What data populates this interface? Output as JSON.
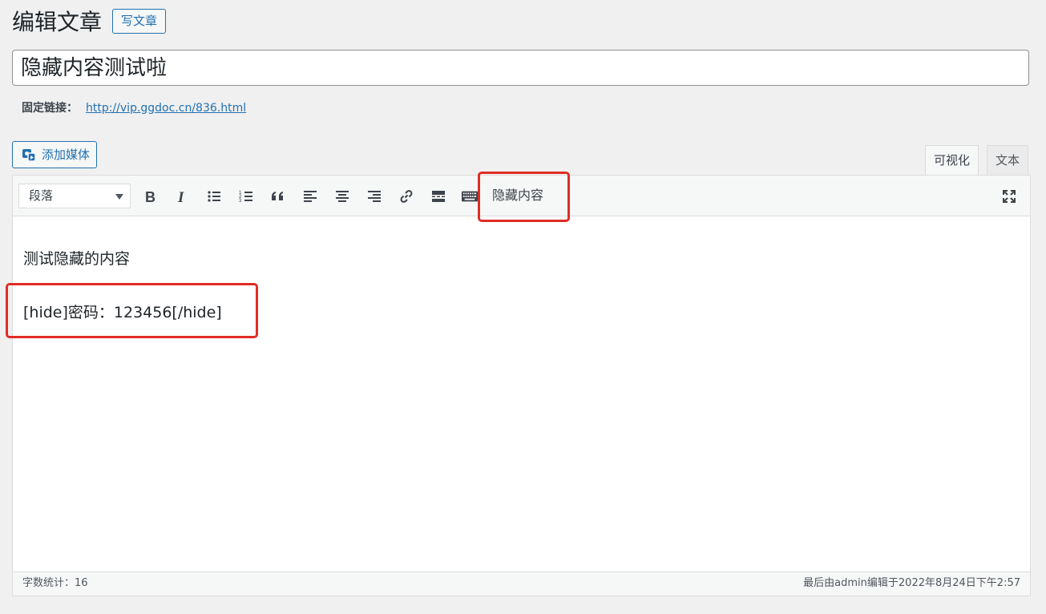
{
  "header": {
    "title": "编辑文章",
    "add_new_label": "写文章"
  },
  "post": {
    "title": "隐藏内容测试啦",
    "permalink_label": "固定链接：",
    "permalink_url": "http://vip.ggdoc.cn/836.html"
  },
  "media": {
    "add_media_label": "添加媒体"
  },
  "tabs": {
    "visual": "可视化",
    "text": "文本"
  },
  "toolbar": {
    "format_selected": "段落",
    "buttons": [
      "bold-icon",
      "italic-icon",
      "bullet-list-icon",
      "numbered-list-icon",
      "blockquote-icon",
      "align-left-icon",
      "align-center-icon",
      "align-right-icon",
      "link-icon",
      "read-more-icon",
      "toolbar-toggle-icon",
      "fullscreen-icon"
    ],
    "hide_content_label": "隐藏内容"
  },
  "content": {
    "paragraph_1": "测试隐藏的内容",
    "paragraph_2": "[hide]密码：123456[/hide]"
  },
  "status": {
    "word_count": "字数统计：16",
    "last_edited": "最后由admin编辑于2022年8月24日下午2:57"
  },
  "colors": {
    "accent": "#2271b1",
    "highlight": "#e02d24",
    "background": "#f0f0f1"
  }
}
